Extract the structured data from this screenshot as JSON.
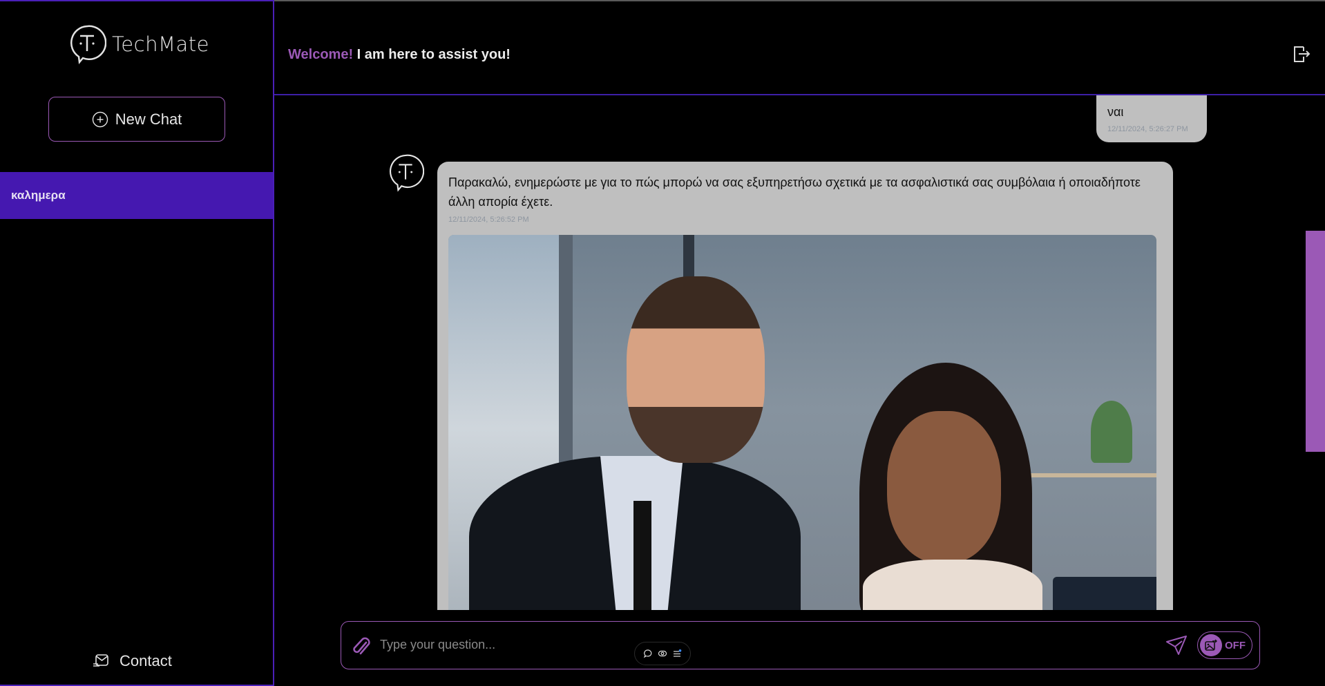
{
  "sidebar": {
    "logo_text": "TechMate",
    "new_chat_label": "New Chat",
    "chats": [
      {
        "label": "καλημερα",
        "active": true
      }
    ],
    "contact_label": "Contact"
  },
  "header": {
    "welcome_accent": "Welcome!",
    "welcome_rest": "I am here to assist you!"
  },
  "messages": [
    {
      "role": "user",
      "text": "ναι",
      "timestamp": "12/11/2024, 5:26:27 PM"
    },
    {
      "role": "assistant",
      "text": "Παρακαλώ, ενημερώστε με για το πώς μπορώ να σας εξυπηρετήσω σχετικά με τα ασφαλιστικά σας συμβόλαια ή οποιαδήποτε άλλη απορία έχετε.",
      "timestamp": "12/11/2024, 5:26:52 PM",
      "image": "two smiling business people in an office"
    }
  ],
  "input": {
    "placeholder": "Type your question...",
    "value": "",
    "image_toggle_label": "OFF",
    "image_toggle_state": "off"
  },
  "colors": {
    "accent": "#9b59b6",
    "active_chat": "#4518b0",
    "border": "#4a1fb8",
    "bubble": "#bfbfbf"
  }
}
